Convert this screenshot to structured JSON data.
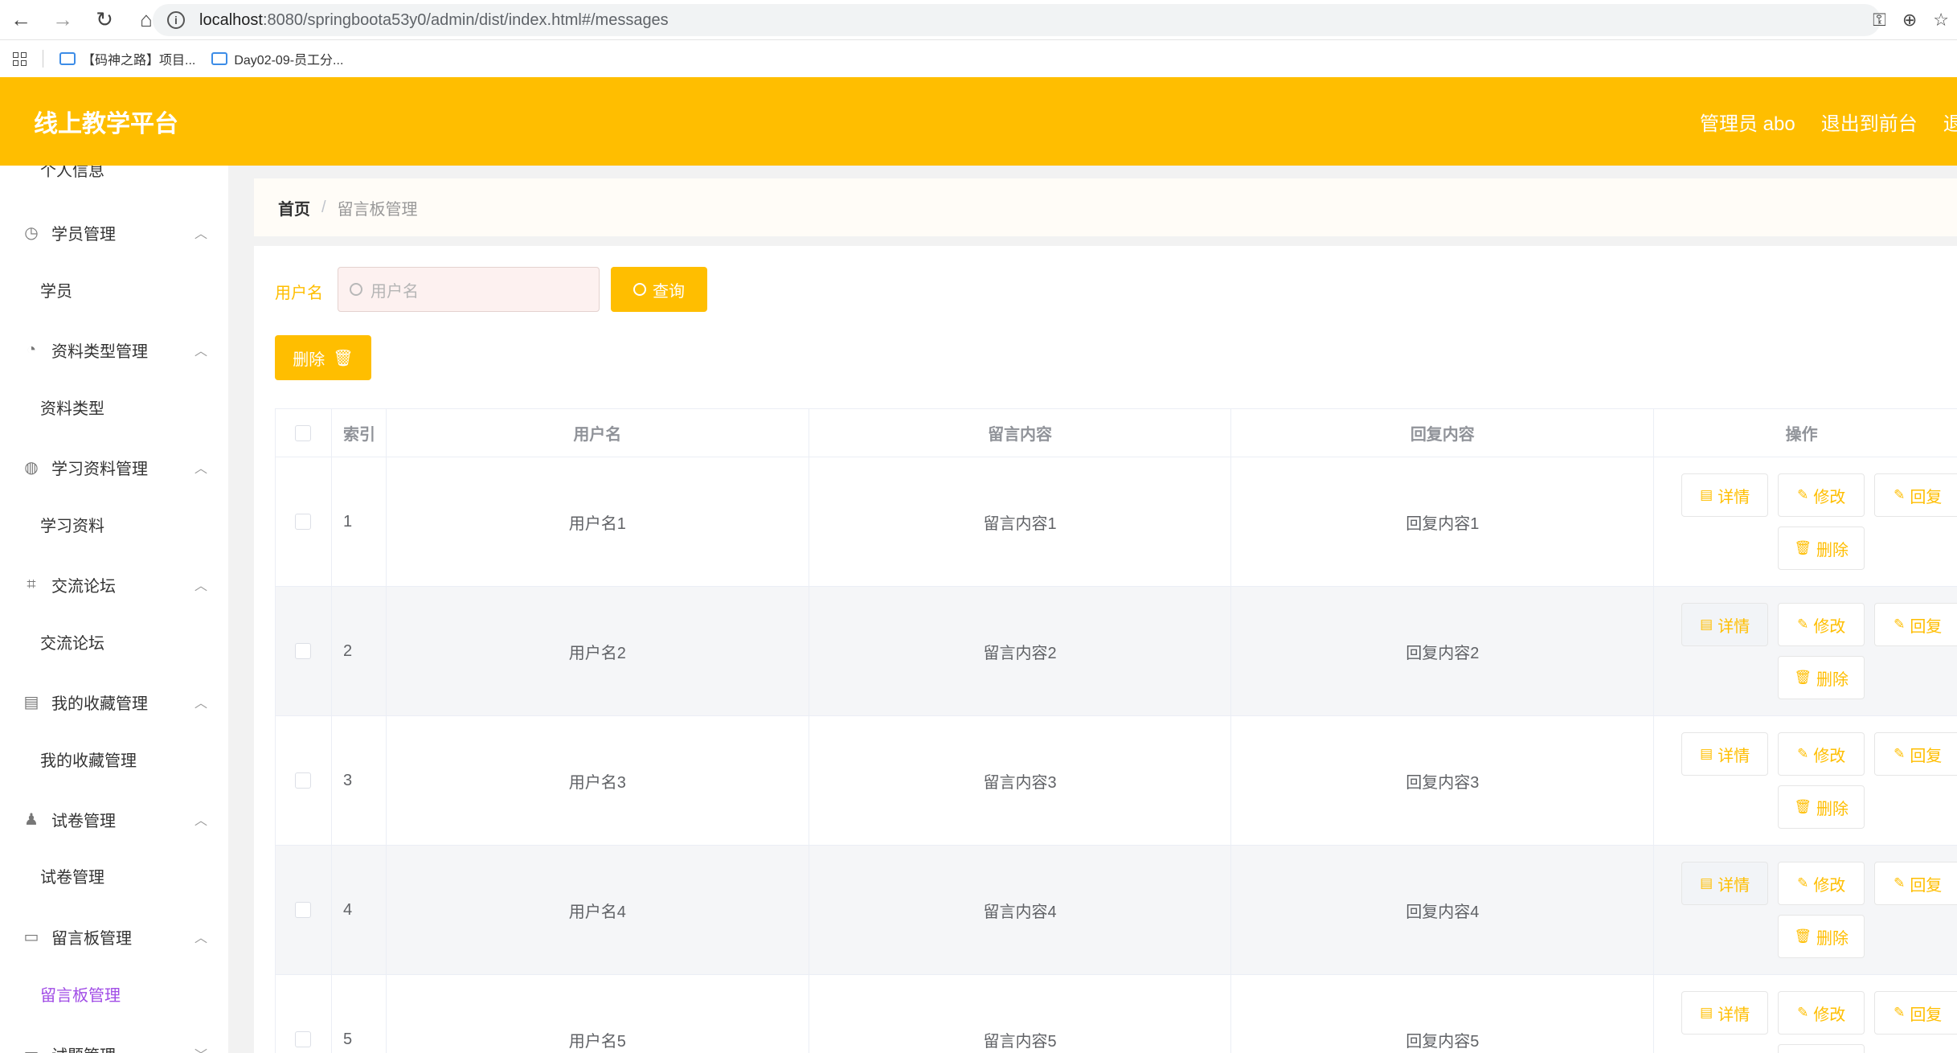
{
  "browser": {
    "url_host": "localhost",
    "url_rest": ":8080/springboota53y0/admin/dist/index.html#/messages",
    "bookmarks": [
      "【码神之路】项目...",
      "Day02-09-员工分..."
    ]
  },
  "header": {
    "title": "线上教学平台",
    "user": "管理员 abo",
    "to_front": "退出到前台",
    "logout": "退出登录"
  },
  "sidebar": {
    "partial_top": "个人信息",
    "groups": [
      {
        "label": "学员管理",
        "sub": "学员"
      },
      {
        "label": "资料类型管理",
        "sub": "资料类型"
      },
      {
        "label": "学习资料管理",
        "sub": "学习资料"
      },
      {
        "label": "交流论坛",
        "sub": "交流论坛"
      },
      {
        "label": "我的收藏管理",
        "sub": "我的收藏管理"
      },
      {
        "label": "试卷管理",
        "sub": "试卷管理"
      },
      {
        "label": "留言板管理",
        "sub": "留言板管理"
      },
      {
        "label": "试题管理",
        "sub": ""
      }
    ]
  },
  "breadcrumb": {
    "home": "首页",
    "current": "留言板管理"
  },
  "search": {
    "label": "用户名",
    "placeholder": "用户名",
    "query_btn": "查询"
  },
  "toolbar": {
    "delete_btn": "删除"
  },
  "table": {
    "headers": {
      "index": "索引",
      "username": "用户名",
      "message": "留言内容",
      "reply": "回复内容",
      "ops": "操作"
    },
    "op_labels": {
      "detail": "详情",
      "edit": "修改",
      "reply": "回复",
      "delete": "删除"
    },
    "rows": [
      {
        "index": "1",
        "username": "用户名1",
        "message": "留言内容1",
        "reply": "回复内容1"
      },
      {
        "index": "2",
        "username": "用户名2",
        "message": "留言内容2",
        "reply": "回复内容2"
      },
      {
        "index": "3",
        "username": "用户名3",
        "message": "留言内容3",
        "reply": "回复内容3"
      },
      {
        "index": "4",
        "username": "用户名4",
        "message": "留言内容4",
        "reply": "回复内容4"
      },
      {
        "index": "5",
        "username": "用户名5",
        "message": "留言内容5",
        "reply": "回复内容5"
      }
    ]
  },
  "colors": {
    "accent": "#ffbe00",
    "active_menu": "#a14de6"
  }
}
